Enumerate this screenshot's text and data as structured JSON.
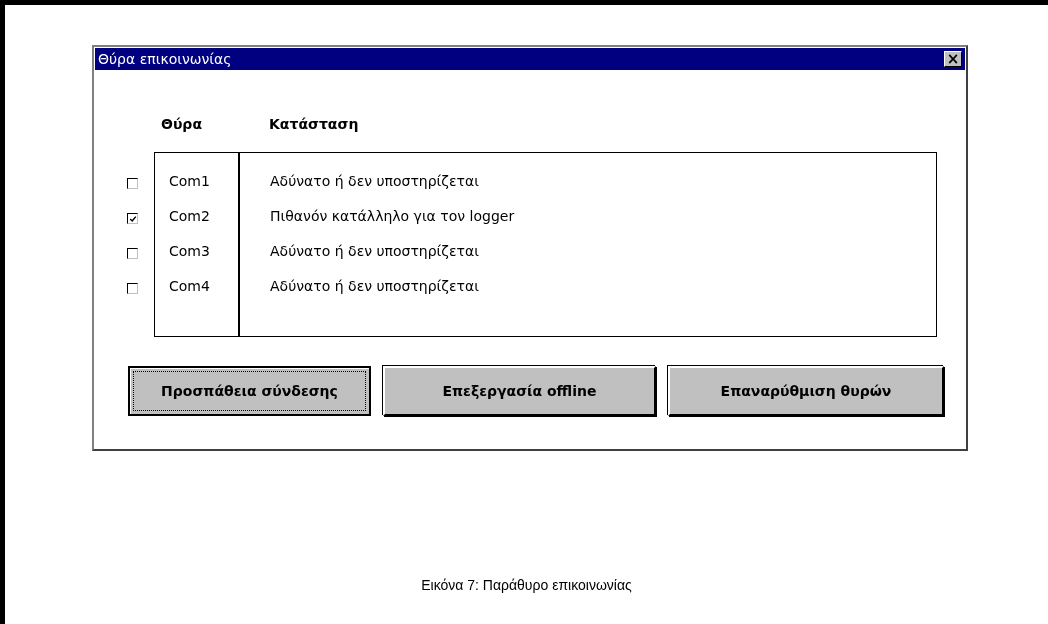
{
  "window": {
    "title": "Θύρα επικοινωνίας",
    "close": "×"
  },
  "columns": [
    "Θύρα",
    "Κατάσταση"
  ],
  "ports": [
    {
      "name": "Com1",
      "status": "Αδύνατο ή δεν υποστηρίζεται",
      "checked": false
    },
    {
      "name": "Com2",
      "status": "Πιθανόν κατάλληλο για τον logger",
      "checked": true
    },
    {
      "name": "Com3",
      "status": "Αδύνατο ή δεν υποστηρίζεται",
      "checked": false
    },
    {
      "name": "Com4",
      "status": "Αδύνατο ή δεν υποστηρίζεται",
      "checked": false
    }
  ],
  "buttons": [
    {
      "label": "Προσπάθεια σύνδεσης",
      "focused": true
    },
    {
      "label": "Επεξεργασία offline",
      "focused": false
    },
    {
      "label": "Επαναρύθμιση θυρών",
      "focused": false
    }
  ],
  "caption": "Εικόνα 7: Παράθυρο επικοινωνίας"
}
